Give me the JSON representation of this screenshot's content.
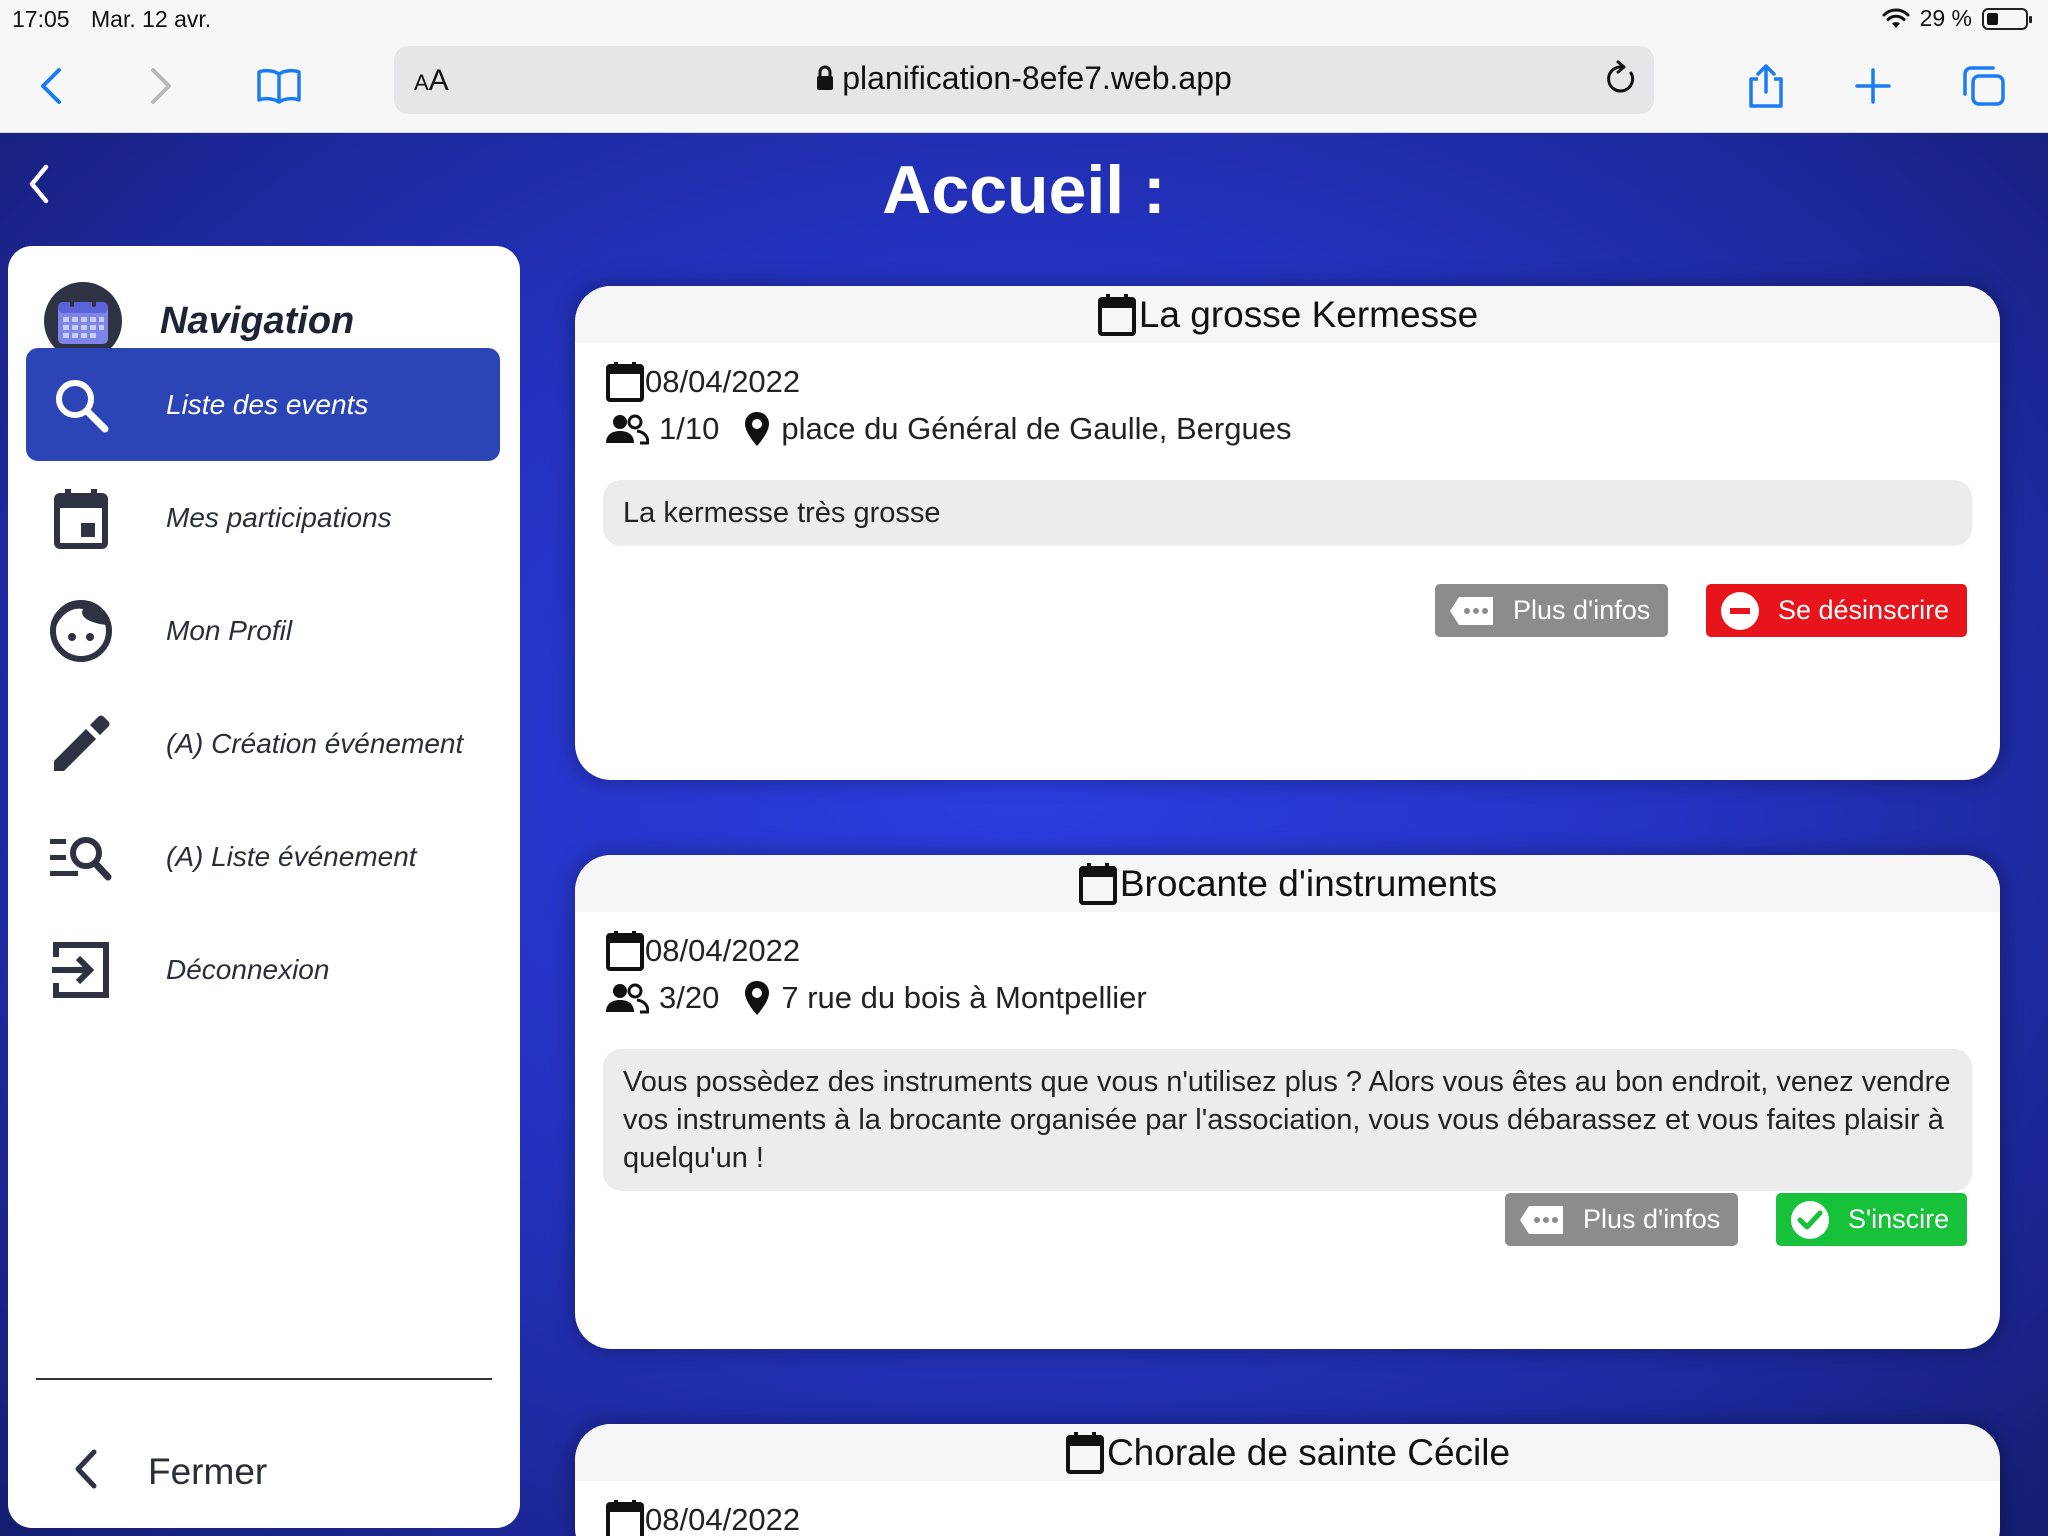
{
  "status_bar": {
    "time": "17:05",
    "date": "Mar. 12 avr.",
    "battery": "29 %"
  },
  "browser": {
    "text_size_label": "AA",
    "url": "planification-8efe7.web.app"
  },
  "app": {
    "title": "Accueil :"
  },
  "sidebar": {
    "title": "Navigation",
    "items": [
      {
        "label": "Liste des events",
        "icon": "search-icon",
        "active": true
      },
      {
        "label": "Mes participations",
        "icon": "calendar-event-icon",
        "active": false
      },
      {
        "label": "Mon Profil",
        "icon": "face-icon",
        "active": false
      },
      {
        "label": "(A) Création événement",
        "icon": "pencil-icon",
        "active": false
      },
      {
        "label": "(A) Liste événement",
        "icon": "list-search-icon",
        "active": false
      },
      {
        "label": "Déconnexion",
        "icon": "logout-icon",
        "active": false
      }
    ],
    "close_label": "Fermer"
  },
  "events": [
    {
      "title": "La grosse Kermesse",
      "date": "08/04/2022",
      "participants": "1/10",
      "location": "place du Général de Gaulle, Bergues",
      "description": "La kermesse très grosse",
      "info_label": "Plus d'infos",
      "action_label": "Se désinscrire",
      "action_type": "unsubscribe"
    },
    {
      "title": "Brocante d'instruments",
      "date": "08/04/2022",
      "participants": "3/20",
      "location": "7 rue du bois à Montpellier",
      "description": "Vous possèdez des instruments que vous n'utilisez plus ? Alors vous êtes au bon endroit, venez vendre vos instruments à la brocante organisée par l'association, vous vous débarassez et vous faites plaisir à quelqu'un !",
      "info_label": "Plus d'infos",
      "action_label": "S'inscire",
      "action_type": "subscribe"
    },
    {
      "title": "Chorale de sainte Cécile",
      "date": "08/04/2022"
    }
  ],
  "colors": {
    "accent_blue": "#2b45b6",
    "background_blue": "#2433c2",
    "unsubscribe_red": "#e8141b",
    "subscribe_green": "#17c13a",
    "info_gray": "#8c8c8c"
  }
}
